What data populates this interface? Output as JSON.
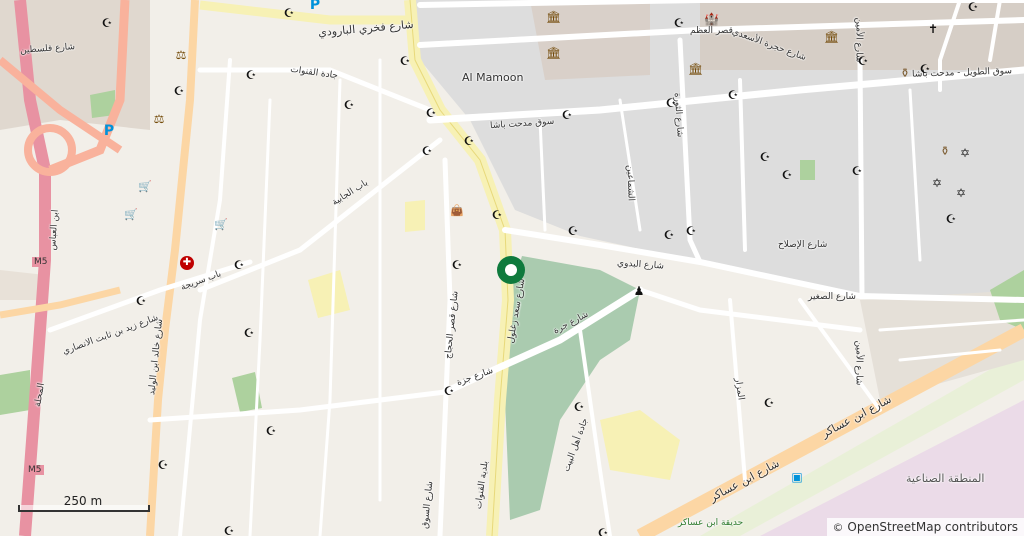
{
  "map": {
    "scale_label": "250 m",
    "attribution": "OpenStreetMap contributors",
    "attribution_prefix": "©",
    "colors": {
      "land": "#f2efe9",
      "urban_grey": "#d9d0c9",
      "old_city_grey": "#dddddd",
      "park": "#add19e",
      "cemetery": "#aacbaf",
      "motorway": "#e892a2",
      "trunk": "#f9b29c",
      "primary": "#fcd6a4",
      "road_white": "#ffffff",
      "industrial": "#ebdbe8",
      "yellow": "#f7f1b5",
      "marker": "#0f7a3d"
    },
    "labels": {
      "falastin": "شارع فلسطين",
      "fakhri": "شارع فخري البارودي",
      "qanawat": "جادة القنوات",
      "jabia": "باب الجابية",
      "sreija": "باب سريجة",
      "zaid": "شارع زيد بن ثابت الانصاري",
      "khaled": "شارع خالد ابن الوليد",
      "abbasiyin": "ابن العباس",
      "m5_top": "M5",
      "m5_bottom": "M5",
      "m5_label": "M5",
      "mahalleh": "المحلة",
      "hajjaj": "شارع قصر الحجاج",
      "jazira": "شارع جزة",
      "sahat": "ساحة",
      "al_mamoon": "Al Mamoon",
      "souq_midhat": "سوق مدحت باشا",
      "thawra": "شارع الثورة",
      "azem": "قصر العظم",
      "amin_top": "شارع الأمين",
      "amin_bottom": "شارع الأمين",
      "tawil": "سوق الطويل - مدحت باشا",
      "taym": "شارع حجرة الأسعدي",
      "bad3i": "شارع البدوي",
      "islah": "شارع الإصلاح",
      "saghir": "شارع الصغير",
      "jarra": "شارع جرة",
      "zaghloul": "شارع سعد زغلول",
      "ibn_asaker_a": "شارع ابن عساكر",
      "ibn_asaker_b": "شارع ابن عساكر",
      "industrial": "المنطقة الصناعية",
      "garden": "حديقة ابن عساكر",
      "ahl_bayt": "جادة أهل البيت",
      "mazar": "المزار",
      "shaghour": "الشماعين",
      "baladiyah": "بلدية القنوات",
      "sawan": "شارع السوق"
    },
    "icons": {
      "mosque": "☪",
      "church": "✝",
      "synagogue": "✡",
      "parking": "P",
      "cart": "🛒",
      "hospital": "✚",
      "bus": "▣",
      "museum": "🏛",
      "monument": "♟",
      "vase": "⚱",
      "scales": "⚖",
      "castle": "🏰",
      "shop_bag": "👜",
      "marker": "⬤"
    }
  }
}
